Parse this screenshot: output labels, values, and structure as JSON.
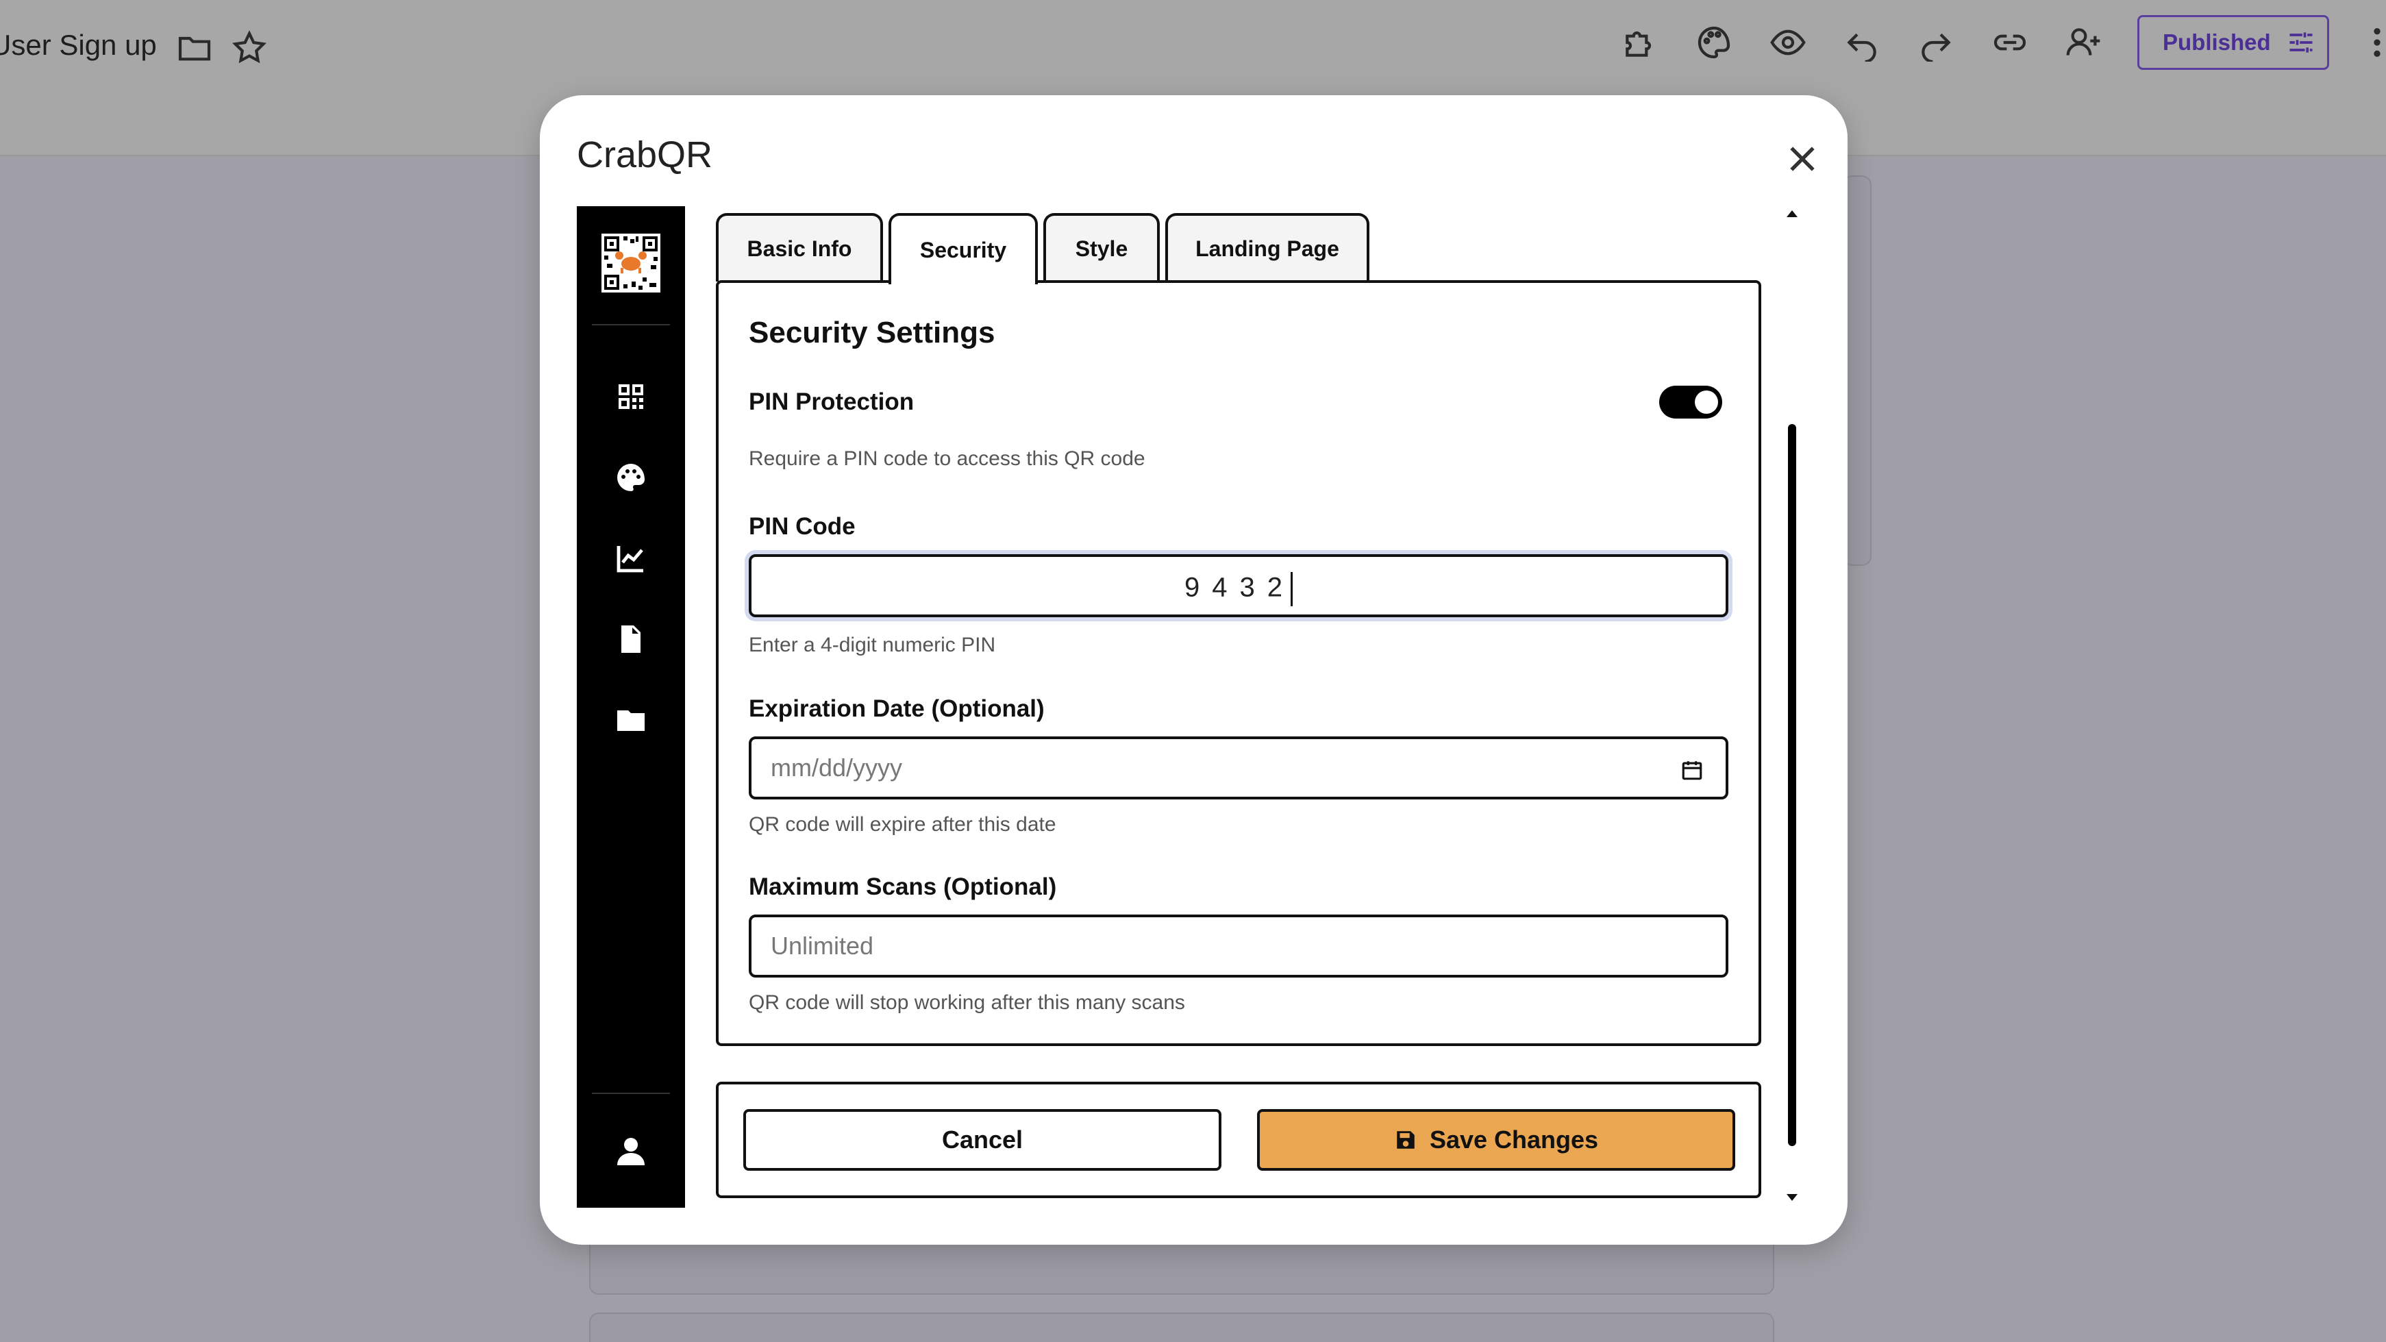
{
  "app": {
    "doc_title": "User Sign up",
    "published_label": "Published"
  },
  "header_icons": [
    "folder-icon",
    "star-icon",
    "puzzle-icon",
    "palette-icon",
    "eye-icon",
    "undo-icon",
    "redo-icon",
    "link-icon",
    "add-person-icon",
    "tune-icon",
    "more-vert-icon"
  ],
  "modal": {
    "title": "CrabQR",
    "close_icon": "close-icon"
  },
  "sidebar": {
    "logo": "crab-qr-logo",
    "items": [
      {
        "icon": "qr-code-icon"
      },
      {
        "icon": "palette-icon"
      },
      {
        "icon": "analytics-icon"
      },
      {
        "icon": "document-icon"
      },
      {
        "icon": "folder-icon"
      }
    ],
    "footer_icon": "user-icon"
  },
  "tabs": [
    {
      "label": "Basic Info",
      "active": false
    },
    {
      "label": "Security",
      "active": true
    },
    {
      "label": "Style",
      "active": false
    },
    {
      "label": "Landing Page",
      "active": false
    }
  ],
  "security": {
    "title": "Security Settings",
    "pin_protection": {
      "label": "PIN Protection",
      "enabled": true,
      "help": "Require a PIN code to access this QR code"
    },
    "pin_code": {
      "label": "PIN Code",
      "value": "9432",
      "help": "Enter a 4-digit numeric PIN"
    },
    "expiration": {
      "label": "Expiration Date (Optional)",
      "placeholder": "mm/dd/yyyy",
      "help": "QR code will expire after this date"
    },
    "max_scans": {
      "label": "Maximum Scans (Optional)",
      "placeholder": "Unlimited",
      "help": "QR code will stop working after this many scans"
    }
  },
  "actions": {
    "cancel_label": "Cancel",
    "save_label": "Save Changes"
  },
  "colors": {
    "accent": "#EBA652",
    "sidebar_bg": "#000000",
    "published": "#4B2E96"
  }
}
